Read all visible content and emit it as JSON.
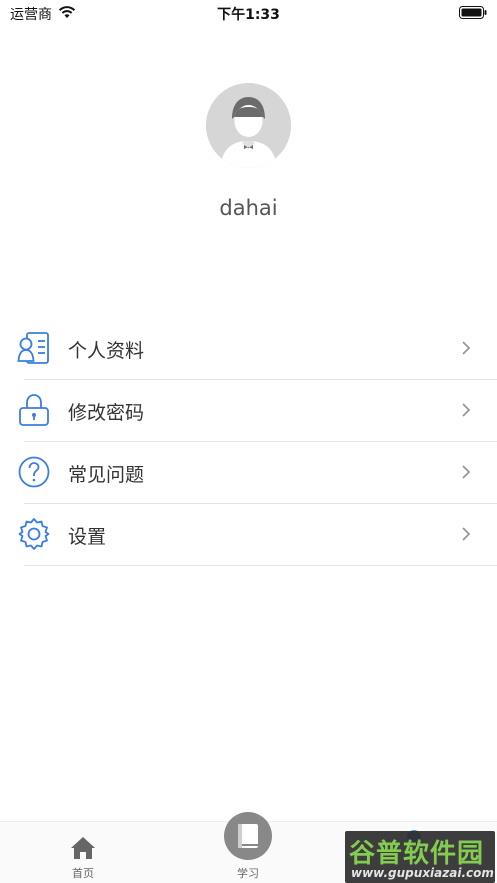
{
  "status_bar": {
    "carrier": "运营商",
    "time": "下午1:33"
  },
  "profile": {
    "username": "dahai"
  },
  "menu": {
    "items": [
      {
        "label": "个人资料",
        "icon": "profile-card-icon"
      },
      {
        "label": "修改密码",
        "icon": "lock-icon"
      },
      {
        "label": "常见问题",
        "icon": "question-icon"
      },
      {
        "label": "设置",
        "icon": "gear-icon"
      }
    ],
    "accent_color": "#3b7ee0"
  },
  "tab_bar": {
    "tabs": [
      {
        "label": "首页",
        "icon": "home-icon"
      },
      {
        "label": "学习",
        "icon": "book-icon"
      }
    ]
  },
  "watermark": {
    "title": "谷普软件园",
    "url": "www.gupuxiazai.com"
  }
}
